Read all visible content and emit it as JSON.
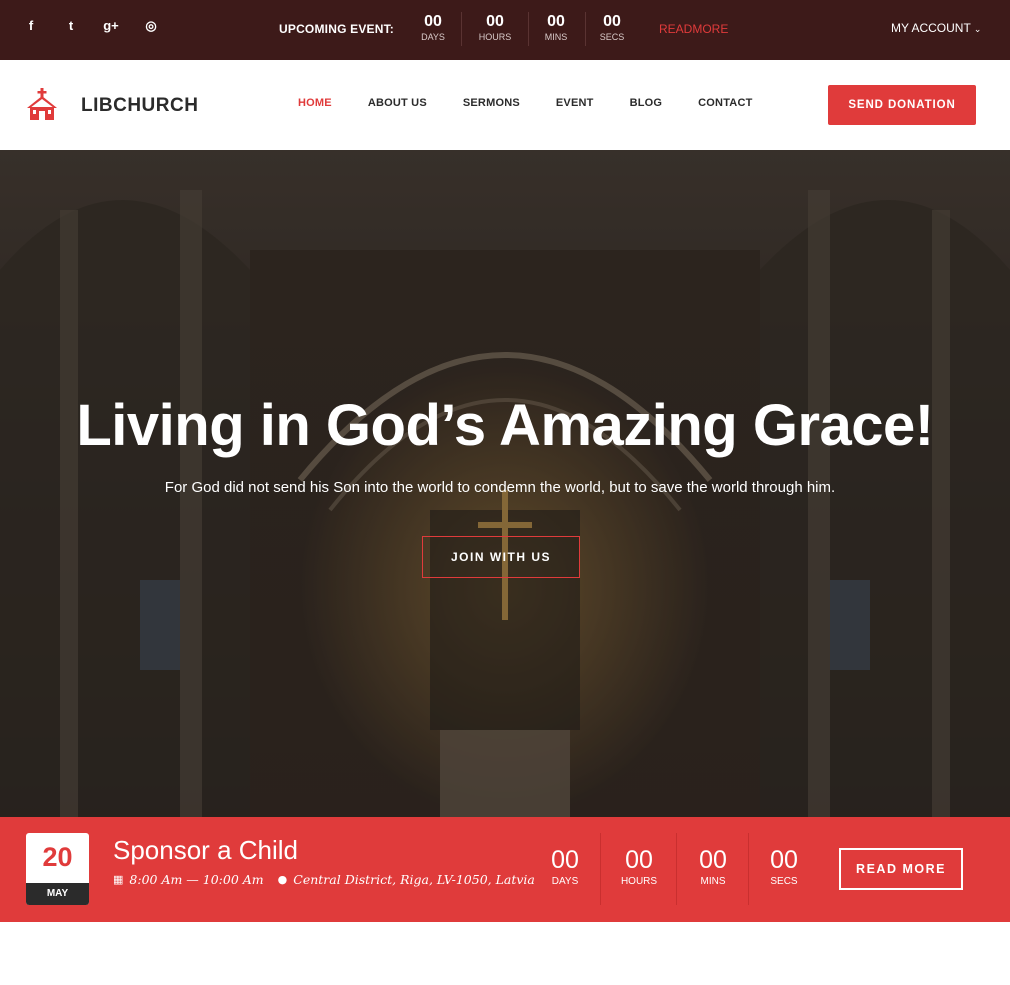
{
  "topbar": {
    "social": [
      {
        "icon": "facebook-icon",
        "glyph": "f"
      },
      {
        "icon": "twitter-icon",
        "glyph": "t"
      },
      {
        "icon": "google-plus-icon",
        "glyph": "g+"
      },
      {
        "icon": "instagram-icon",
        "glyph": "◎"
      }
    ],
    "upcoming_label": "UPCOMING EVENT:",
    "countdown": [
      {
        "value": "00",
        "label": "DAYS"
      },
      {
        "value": "00",
        "label": "HOURS"
      },
      {
        "value": "00",
        "label": "MINS"
      },
      {
        "value": "00",
        "label": "SECS"
      }
    ],
    "readmore": "READMORE",
    "account": "MY ACCOUNT"
  },
  "header": {
    "logo_text": "LIBCHURCH",
    "nav": [
      {
        "label": "HOME",
        "active": true
      },
      {
        "label": "ABOUT US",
        "active": false
      },
      {
        "label": "SERMONS",
        "active": false
      },
      {
        "label": "EVENT",
        "active": false
      },
      {
        "label": "BLOG",
        "active": false
      },
      {
        "label": "CONTACT",
        "active": false
      }
    ],
    "donate_label": "SEND DONATION"
  },
  "hero": {
    "title": "Living in God’s Amazing Grace!",
    "subtitle": "For God did not send his Son into the world to condemn the world, but to save the world through him.",
    "button": "JOIN WITH US"
  },
  "event": {
    "day": "20",
    "month": "MAY",
    "title": "Sponsor a Child",
    "time": "8:00 Am — 10:00 Am",
    "location": "Central District, Riga, LV-1050, Latvia",
    "countdown": [
      {
        "value": "00",
        "label": "DAYS"
      },
      {
        "value": "00",
        "label": "HOURS"
      },
      {
        "value": "00",
        "label": "MINS"
      },
      {
        "value": "00",
        "label": "SECS"
      }
    ],
    "button": "READ MORE"
  },
  "colors": {
    "accent": "#e03b3b",
    "topbar_bg": "#3d1a19",
    "dark_text": "#2b2b2b"
  }
}
